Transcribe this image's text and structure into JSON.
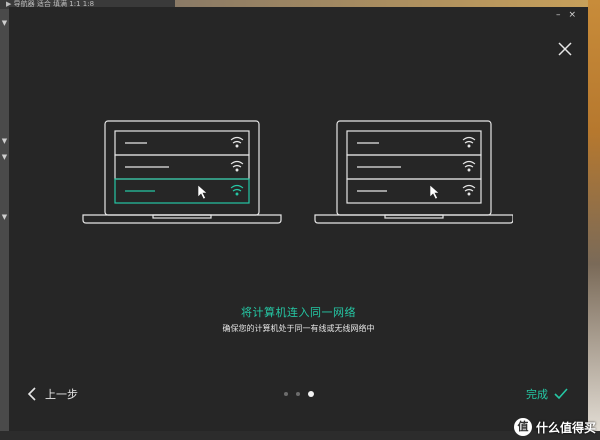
{
  "background": {
    "topbar_text": "▶ 导航器      适合  填满  1:1  1:8",
    "watermark_badge": "值",
    "watermark_text": "什么值得买"
  },
  "window": {
    "minimize_label": "–",
    "close_label": "×"
  },
  "content": {
    "title": "将计算机连入同一网络",
    "subtitle": "确保您的计算机处于同一有线或无线网络中"
  },
  "footer": {
    "back_label": "上一步",
    "done_label": "完成",
    "pages": 3,
    "active_page": 3
  },
  "colors": {
    "accent": "#25c7a4",
    "dialog_bg": "#262626",
    "line": "#e6e6e6"
  },
  "icons": {
    "close": "close-icon",
    "back": "chevron-left-icon",
    "done": "checkmark-icon",
    "wifi": "wifi-icon",
    "cursor": "mouse-pointer-icon"
  }
}
